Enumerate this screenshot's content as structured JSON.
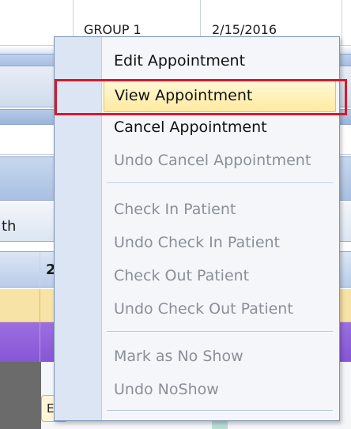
{
  "grid": {
    "group_name": "GROUP 1",
    "date": "2/15/2016",
    "month_label_fragment": "th",
    "day_header_fragment": "2",
    "appointment_chip_fragment": "E"
  },
  "context_menu": {
    "items": [
      {
        "label": "Edit Appointment",
        "enabled": true
      },
      {
        "label": "View Appointment",
        "enabled": true,
        "highlighted": true
      },
      {
        "label": "Cancel Appointment",
        "enabled": true
      },
      {
        "label": "Undo Cancel Appointment",
        "enabled": false
      },
      {
        "label": "Check In Patient",
        "enabled": false
      },
      {
        "label": "Undo Check In Patient",
        "enabled": false
      },
      {
        "label": "Check Out Patient",
        "enabled": false
      },
      {
        "label": "Undo Check Out Patient",
        "enabled": false
      },
      {
        "label": "Mark as No Show",
        "enabled": false
      },
      {
        "label": "Undo NoShow",
        "enabled": false
      }
    ]
  },
  "colors": {
    "highlight_outline": "#d9182a",
    "hover_item": "#ffeaa0",
    "disabled_text": "#8a8f98",
    "appointment_purple": "#8756d6",
    "appointment_yellow": "#f7e3a6"
  }
}
